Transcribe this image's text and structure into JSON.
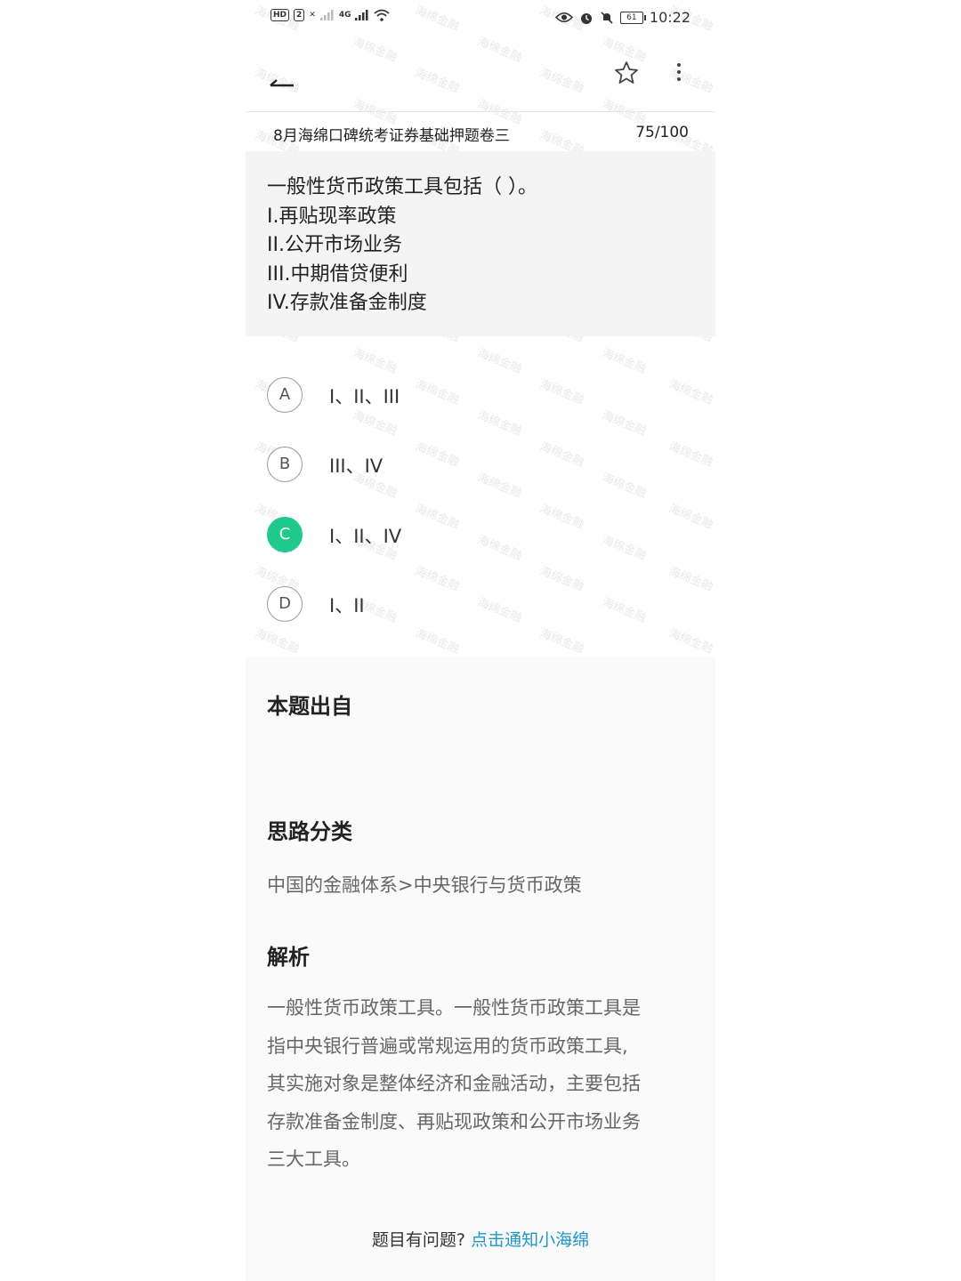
{
  "status_bar": {
    "left_badges": [
      "HD",
      "2"
    ],
    "net_labels": [
      "✕",
      "4G"
    ],
    "battery_level": "61",
    "time": "10:22"
  },
  "toolbar": {
    "back_icon": "arrow-left-icon",
    "favorite_icon": "star-outline-icon",
    "more_icon": "more-vertical-icon"
  },
  "exam": {
    "title": "8月海绵口碑统考证券基础押题卷三",
    "progress": "75/100"
  },
  "question": {
    "text": "一般性货币政策工具包括（ ）。\nI.再贴现率政策\nII.公开市场业务\nIII.中期借贷便利\nIV.存款准备金制度"
  },
  "options": [
    {
      "letter": "A",
      "text": "I、II、III",
      "selected": false
    },
    {
      "letter": "B",
      "text": "III、IV",
      "selected": false
    },
    {
      "letter": "C",
      "text": "I、II、IV",
      "selected": true
    },
    {
      "letter": "D",
      "text": "I、II",
      "selected": false
    }
  ],
  "source_section": {
    "heading": "本题出自"
  },
  "category_section": {
    "heading": "思路分类",
    "text": "中国的金融体系>中央银行与货币政策"
  },
  "analysis_section": {
    "heading": "解析",
    "text": "一般性货币政策工具。一般性货币政策工具是\n指中央银行普遍或常规运用的货币政策工具,\n其实施对象是整体经济和金融活动，主要包括\n存款准备金制度、再贴现政策和公开市场业务\n三大工具。"
  },
  "feedback": {
    "prompt": "题目有问题?",
    "link": "点击通知小海绵"
  },
  "watermark": {
    "text": "海绵金融"
  },
  "colors": {
    "accent": "#1fc98e",
    "link": "#2196c9"
  }
}
